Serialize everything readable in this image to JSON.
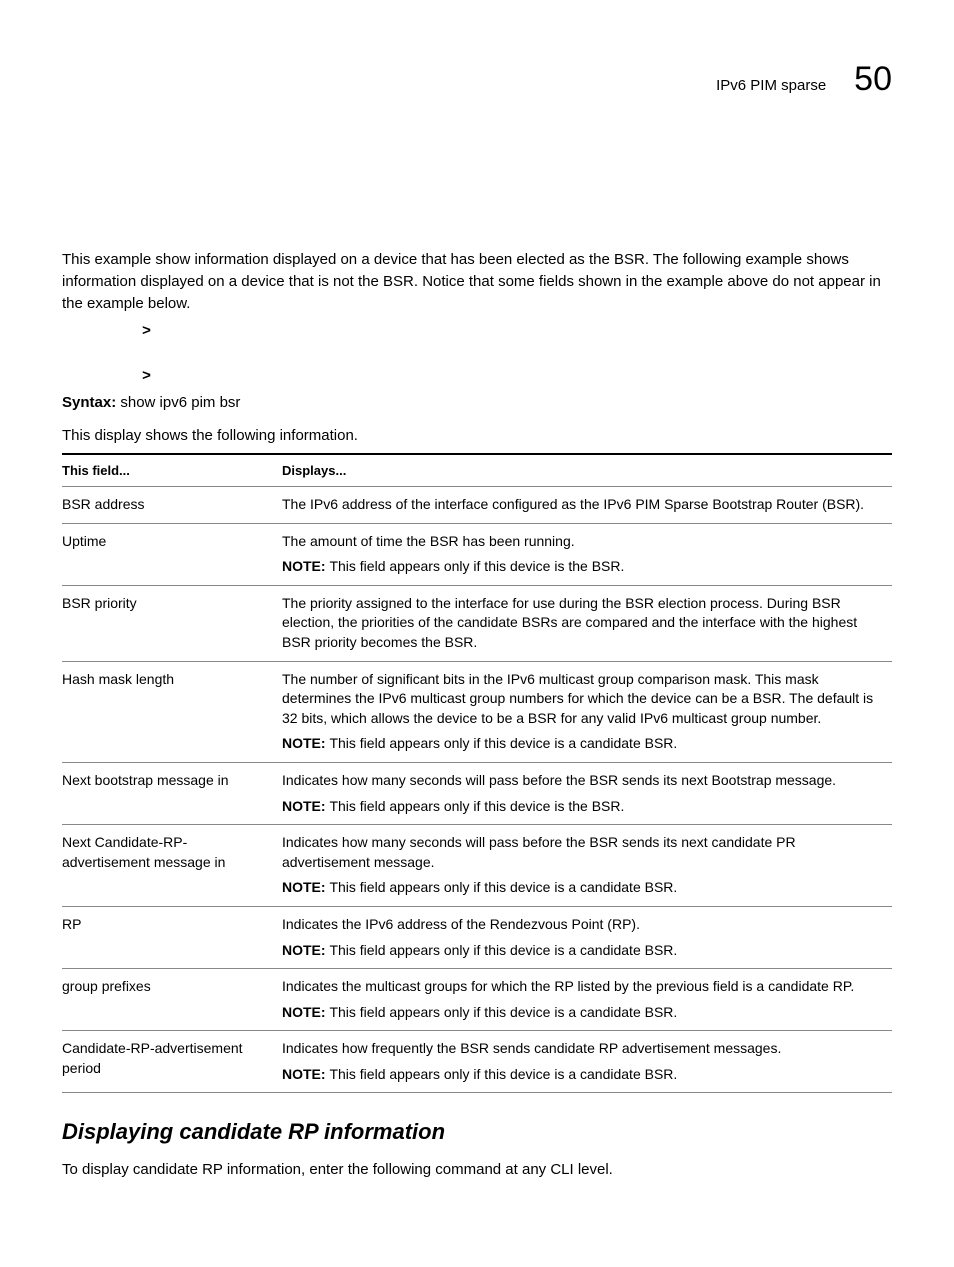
{
  "header": {
    "running": "IPv6 PIM sparse",
    "page": "50"
  },
  "intro": "This example show information displayed on a device that has been elected as the BSR.  The following example shows information displayed on a device that is not the BSR.  Notice that some fields shown in the example above do not appear in the example below.",
  "syntax": {
    "label": "Syntax:",
    "command": "show ipv6 pim bsr"
  },
  "tableIntro": "This display shows the following information.",
  "tableHead": {
    "field": "This field...",
    "displays": "Displays..."
  },
  "rows": [
    {
      "field": "BSR address",
      "desc": "The IPv6 address of the interface configured as the IPv6 PIM Sparse Bootstrap Router (BSR).",
      "note": ""
    },
    {
      "field": "Uptime",
      "desc": "The amount of time the BSR has been running.",
      "note": "This field appears only if this device is the BSR."
    },
    {
      "field": "BSR priority",
      "desc": "The priority assigned to the interface for use during the BSR election process.  During BSR election, the priorities of the candidate BSRs are compared and the interface with the highest BSR priority becomes the BSR.",
      "note": ""
    },
    {
      "field": "Hash mask length",
      "desc": "The number of significant bits in the IPv6 multicast group comparison mask.  This mask determines the IPv6 multicast group numbers for which the device can be a BSR.  The default is 32 bits, which allows the device to be a BSR for any valid IPv6 multicast group number.",
      "note": "This field appears only if this device is a candidate BSR."
    },
    {
      "field": "Next bootstrap message in",
      "desc": "Indicates how many seconds will pass before the BSR sends its next Bootstrap message.",
      "note": "This field appears only if this device is the BSR."
    },
    {
      "field": "Next Candidate-RP-advertisement message in",
      "desc": "Indicates how many seconds will pass before the BSR sends its next candidate PR advertisement message.",
      "note": "This field appears only if this device is a candidate BSR."
    },
    {
      "field": "RP",
      "desc": "Indicates the IPv6 address of the Rendezvous Point (RP).",
      "note": "This field appears  only if this device is a candidate BSR."
    },
    {
      "field": "group prefixes",
      "desc": "Indicates the multicast groups for which the RP listed by the previous field is a candidate RP.",
      "note": "This field appears only if this device is a candidate BSR."
    },
    {
      "field": "Candidate-RP-advertisement period",
      "desc": "Indicates how frequently the BSR sends candidate RP advertisement messages.",
      "note": "This field appears only if this device is a candidate BSR."
    }
  ],
  "noteLabel": "NOTE:  ",
  "section": {
    "title": "Displaying candidate RP information",
    "body": "To display candidate RP information, enter the following command at any CLI level."
  }
}
